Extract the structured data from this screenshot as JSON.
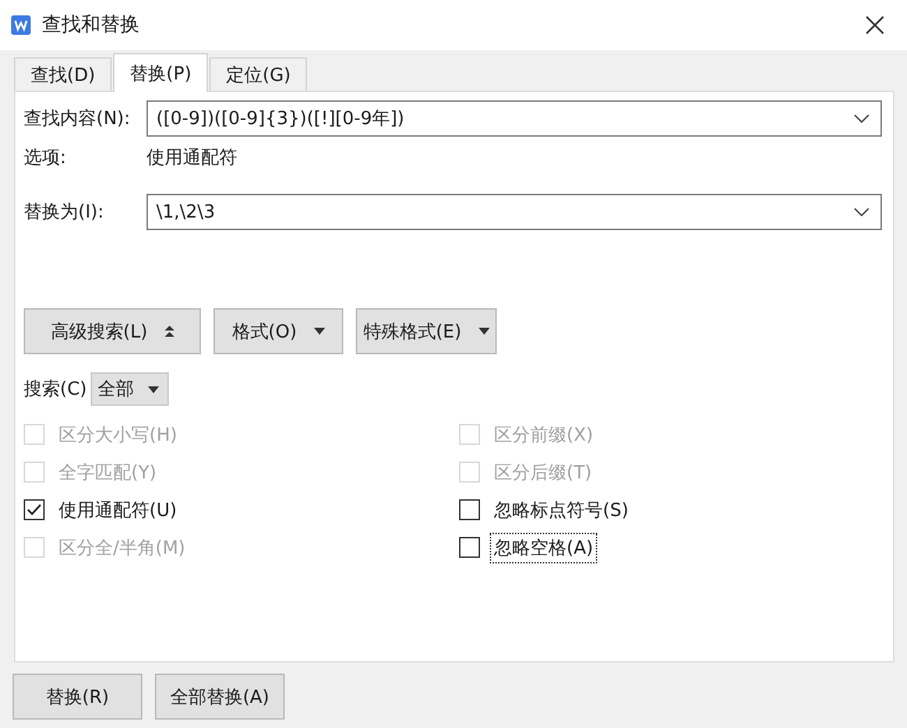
{
  "window": {
    "title": "查找和替换"
  },
  "tabs": [
    {
      "label": "查找(D)",
      "selected": false
    },
    {
      "label": "替换(P)",
      "selected": true
    },
    {
      "label": "定位(G)",
      "selected": false
    }
  ],
  "find": {
    "label": "查找内容(N):",
    "value": "([0-9])([0-9]{3})([!][0-9年])"
  },
  "options": {
    "label": "选项:",
    "value": "使用通配符"
  },
  "replace": {
    "label": "替换为(I):",
    "value": "\\1,\\2\\3"
  },
  "tool_buttons": [
    {
      "label": "高级搜索(L)",
      "kind": "expand"
    },
    {
      "label": "格式(O)",
      "kind": "menu"
    },
    {
      "label": "特殊格式(E)",
      "kind": "menu"
    }
  ],
  "search": {
    "label": "搜索(C)",
    "value": "全部"
  },
  "checkboxes": [
    {
      "label": "区分大小写(H)",
      "checked": false,
      "disabled": true,
      "focused": false
    },
    {
      "label": "区分前缀(X)",
      "checked": false,
      "disabled": true,
      "focused": false
    },
    {
      "label": "全字匹配(Y)",
      "checked": false,
      "disabled": true,
      "focused": false
    },
    {
      "label": "区分后缀(T)",
      "checked": false,
      "disabled": true,
      "focused": false
    },
    {
      "label": "使用通配符(U)",
      "checked": true,
      "disabled": false,
      "focused": false
    },
    {
      "label": "忽略标点符号(S)",
      "checked": false,
      "disabled": false,
      "focused": false
    },
    {
      "label": "区分全/半角(M)",
      "checked": false,
      "disabled": true,
      "focused": false
    },
    {
      "label": "忽略空格(A)",
      "checked": false,
      "disabled": false,
      "focused": true
    }
  ],
  "buttons": [
    "替换(R)",
    "全部替换(A)"
  ]
}
